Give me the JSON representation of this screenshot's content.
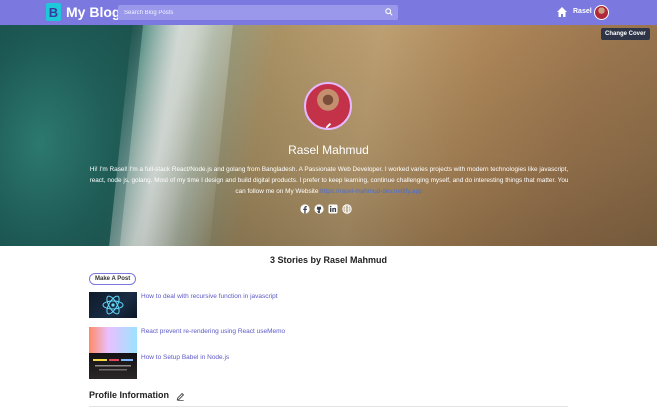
{
  "header": {
    "logo_badge": "B",
    "brand": "My Blog",
    "search_placeholder": "Search Blog Posts",
    "user_name": "Rasel"
  },
  "cover": {
    "change_cover_label": "Change Cover"
  },
  "profile": {
    "name": "Rasel Mahmud",
    "bio": "Hi! I'm Rasel! I'm a full-stack React/Node.js and golang from Bangladesh. A Passionate Web Developer. I worked varies projects with modern technologies like javascript, react, node js, golang. Most of my time I design and build digital products. I prefer to keep learning, continue challenging myself, and do interesting things that matter. You can follow me on My Website",
    "website_link": "https://rasel-mahmud-dev.netlify.app"
  },
  "stories": {
    "heading": "3 Stories by Rasel Mahmud",
    "make_post_label": "Make A Post",
    "items": [
      {
        "title": "How to deal with recursive function in javascript"
      },
      {
        "title": "React prevent re-rendering using React useMemo"
      },
      {
        "title": "How to Setup Babel in Node.js"
      }
    ]
  },
  "profile_info": {
    "heading": "Profile Information"
  },
  "colors": {
    "navbar": "#7b78e0",
    "accent_link": "#5b59c5"
  },
  "icons": {
    "search": "search-icon",
    "home": "home-icon",
    "facebook": "facebook-icon",
    "github": "github-icon",
    "linkedin": "linkedin-icon",
    "website": "globe-icon",
    "edit": "pencil-icon"
  }
}
